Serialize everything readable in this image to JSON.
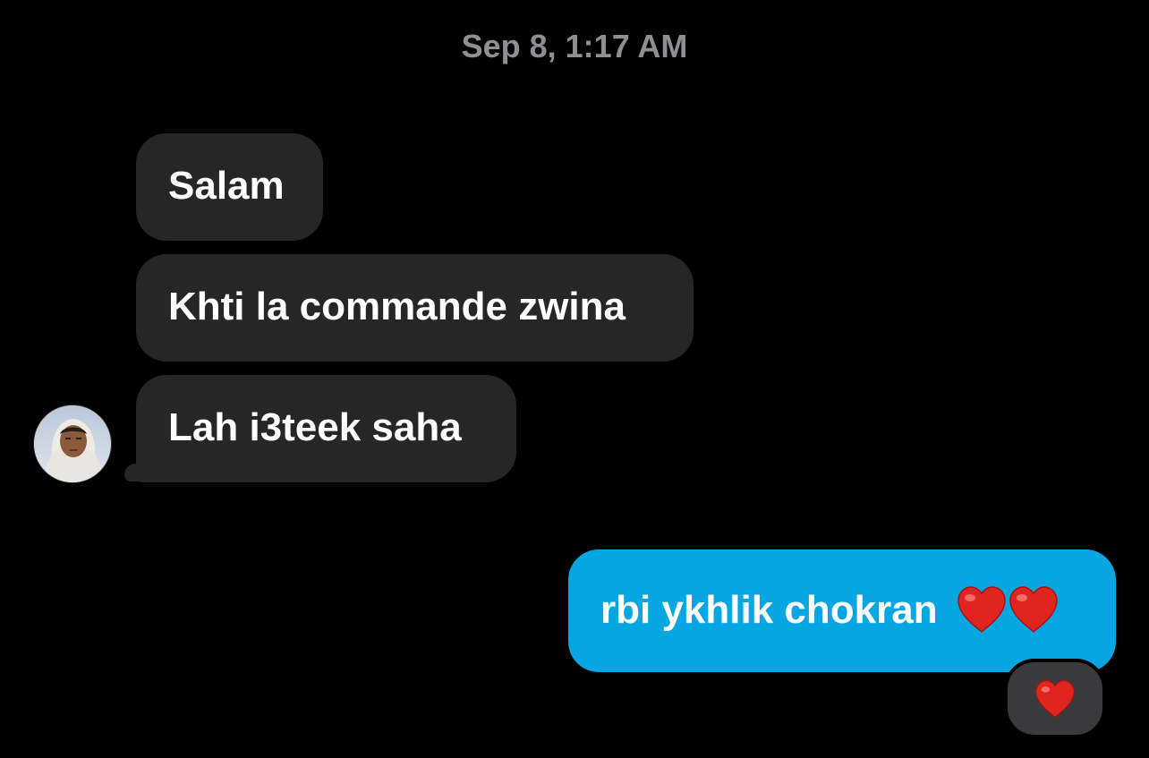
{
  "conversation": {
    "timestamp": "Sep 8, 1:17 AM",
    "incoming_messages": [
      {
        "text": "Salam"
      },
      {
        "text": "Khti la commande zwina"
      },
      {
        "text": "Lah i3teek saha"
      }
    ],
    "outgoing_messages": [
      {
        "text": "rbi ykhlik chokran",
        "emoji": "❤️❤️"
      }
    ],
    "reaction": {
      "emoji": "❤️",
      "icon": "heart-icon"
    }
  },
  "colors": {
    "background": "#000000",
    "incoming_bubble": "#262626",
    "outgoing_bubble": "#05a6e2",
    "reaction_bubble": "#3a3a3c",
    "heart": "#e0241f",
    "timestamp_text": "#8e8e93"
  },
  "avatar": {
    "icon": "contact-avatar"
  }
}
